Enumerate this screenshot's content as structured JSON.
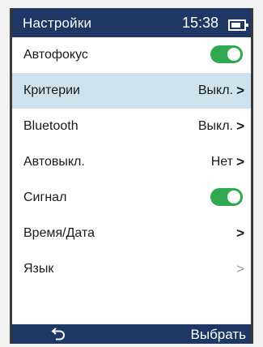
{
  "status": {
    "title": "Настройки",
    "time": "15:38",
    "battery_level": 0.75
  },
  "settings": [
    {
      "label": "Автофокус",
      "type": "toggle",
      "state": "on"
    },
    {
      "label": "Критерии",
      "type": "value",
      "value": "Выкл.",
      "selected": true
    },
    {
      "label": "Bluetooth",
      "type": "value",
      "value": "Выкл."
    },
    {
      "label": "Автовыкл.",
      "type": "value",
      "value": "Нет"
    },
    {
      "label": "Сигнал",
      "type": "toggle",
      "state": "on"
    },
    {
      "label": "Время/Дата",
      "type": "nav"
    },
    {
      "label": "Язык",
      "type": "nav"
    }
  ],
  "softkeys": {
    "left_icon": "back-arrow-icon",
    "right_label": "Выбрать"
  },
  "colors": {
    "header": "#1e3764",
    "selected_row": "#cfe3ee",
    "toggle_on": "#2fa84f"
  }
}
